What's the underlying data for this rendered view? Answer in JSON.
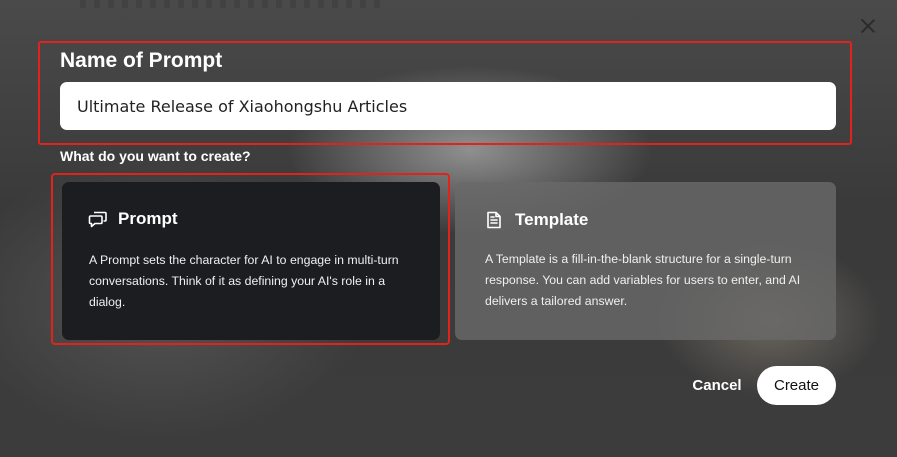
{
  "dialog": {
    "name_label": "Name of Prompt",
    "name_value": "Ultimate Release of Xiaohongshu Articles",
    "question": "What do you want to create?",
    "options": [
      {
        "title": "Prompt",
        "icon": "chat-bubbles-icon",
        "description": "A Prompt sets the character for AI to engage in multi-turn conversations. Think of it as defining your AI's role in a dialog.",
        "selected": true
      },
      {
        "title": "Template",
        "icon": "document-icon",
        "description": "A Template is a fill-in-the-blank structure for a single-turn response. You can add variables for users to enter, and AI delivers a tailored answer.",
        "selected": false
      }
    ],
    "cancel_label": "Cancel",
    "create_label": "Create",
    "close_icon": "close-icon"
  },
  "colors": {
    "highlight": "#e0241c",
    "selected_card": "#1c1d21",
    "unselected_card": "#696969"
  }
}
